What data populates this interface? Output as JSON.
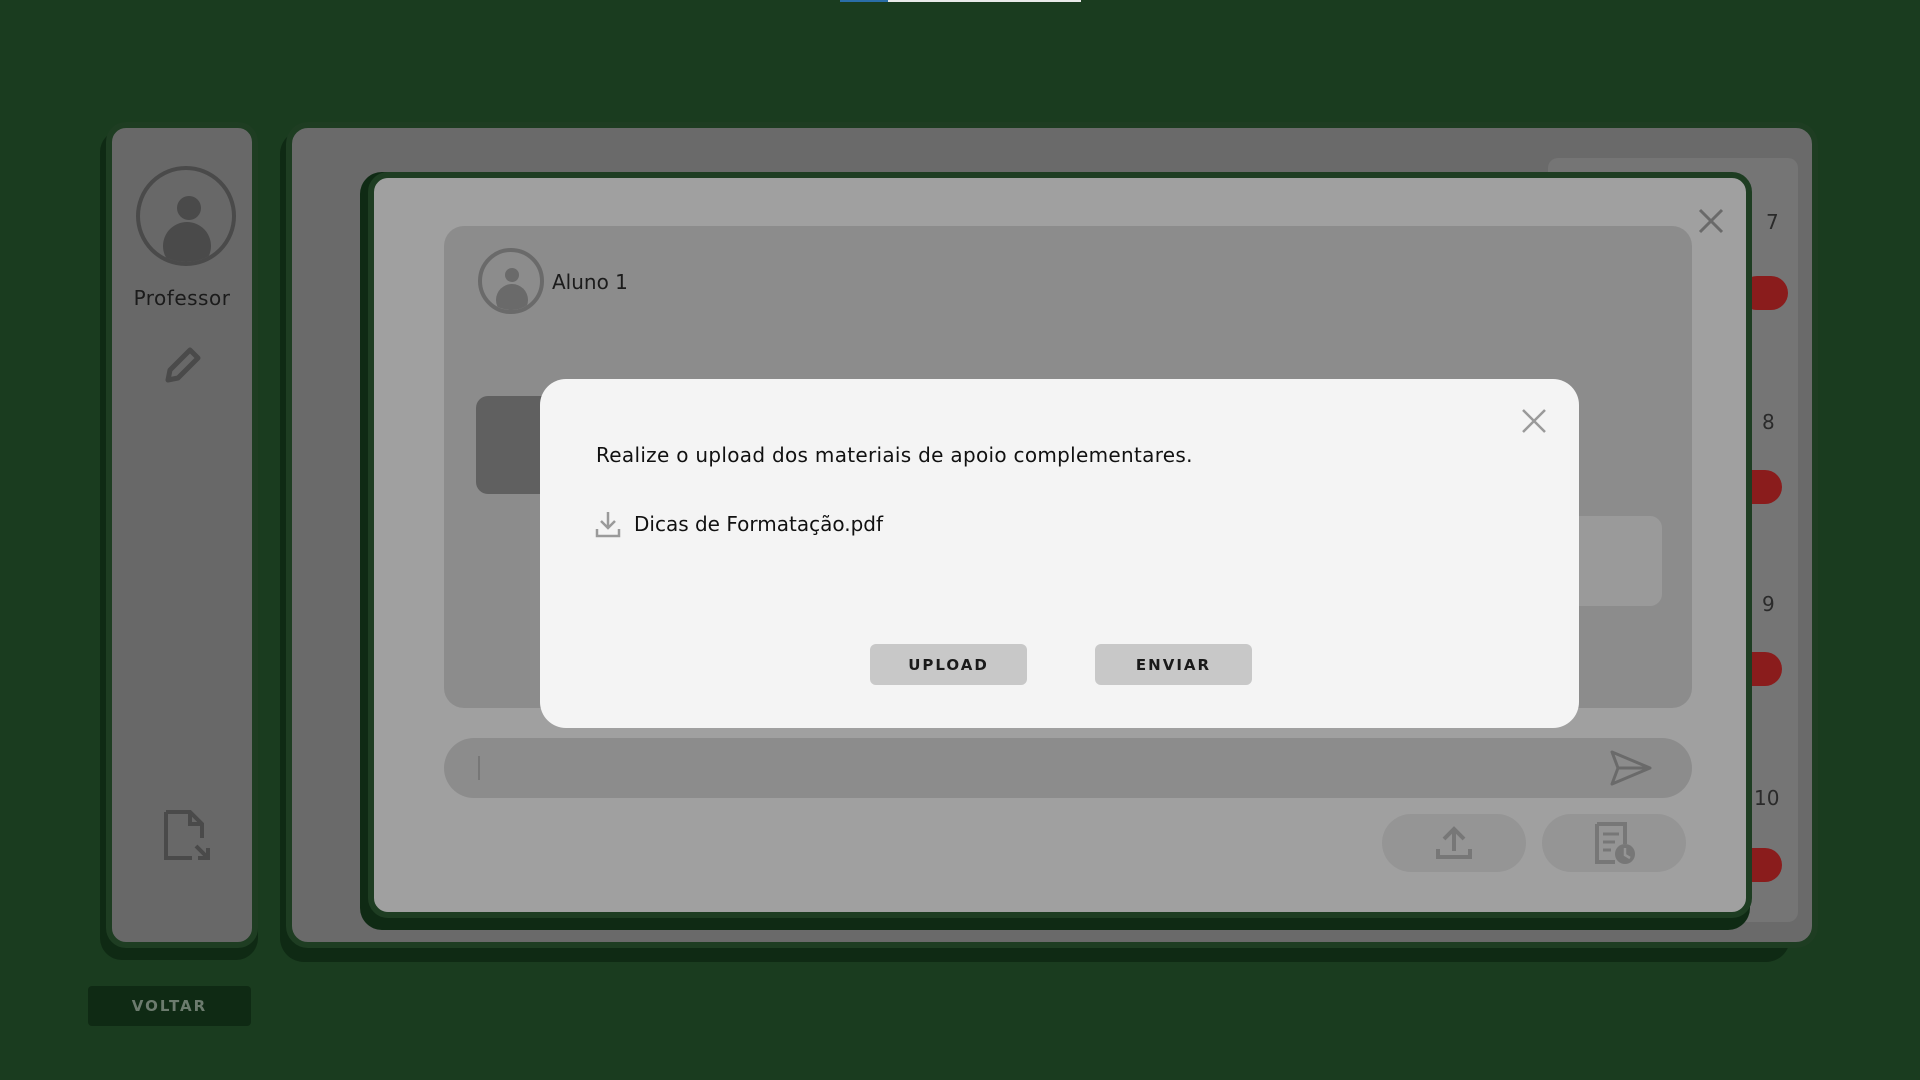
{
  "sidebar": {
    "user_name": "Professor",
    "icons": [
      "avatar",
      "pencil-icon",
      "file-export-icon"
    ]
  },
  "back_button": {
    "label": "VOLTAR"
  },
  "right_column": {
    "numbers": [
      "7",
      "8",
      "9",
      "10"
    ]
  },
  "chat": {
    "student_name": "Aluno 1",
    "message_input": {
      "value": ""
    },
    "icons": [
      "close-icon",
      "send-icon",
      "upload-icon",
      "report-clock-icon"
    ]
  },
  "dialog": {
    "message": "Realize o upload dos materiais de apoio complementares.",
    "file": {
      "name": "Dicas de Formatação.pdf",
      "icon": "download-icon"
    },
    "upload_label": "UPLOAD",
    "send_label": "ENVIAR"
  },
  "colors": {
    "background": "#1a3c1f",
    "dialog": "#f4f4f4",
    "badge": "#8a1c1c"
  }
}
